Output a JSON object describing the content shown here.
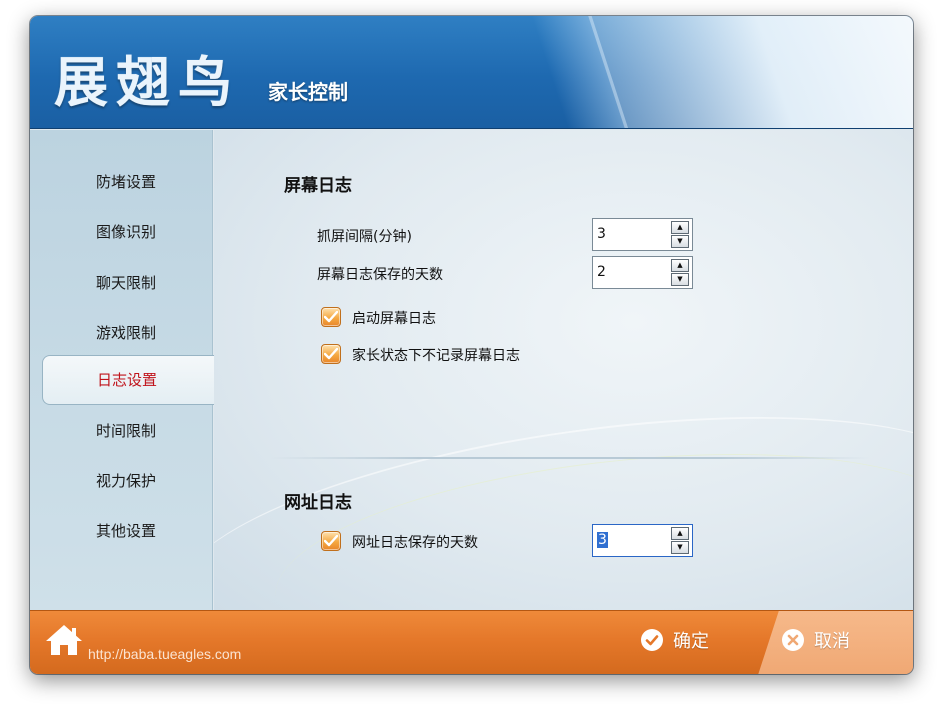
{
  "header": {
    "logo": "展翅鸟",
    "subtitle": "家长控制"
  },
  "sidebar": {
    "items": [
      {
        "label": "防堵设置",
        "active": false
      },
      {
        "label": "图像识别",
        "active": false
      },
      {
        "label": "聊天限制",
        "active": false
      },
      {
        "label": "游戏限制",
        "active": false
      },
      {
        "label": "日志设置",
        "active": true
      },
      {
        "label": "时间限制",
        "active": false
      },
      {
        "label": "视力保护",
        "active": false
      },
      {
        "label": "其他设置",
        "active": false
      }
    ]
  },
  "screen_log": {
    "title": "屏幕日志",
    "interval_label": "抓屏间隔(分钟)",
    "interval_value": "3",
    "keep_days_label": "屏幕日志保存的天数",
    "keep_days_value": "2",
    "enable_label": "启动屏幕日志",
    "enable_checked": true,
    "parent_mode_label": "家长状态下不记录屏幕日志",
    "parent_mode_checked": true
  },
  "url_log": {
    "title": "网址日志",
    "keep_days_label": "网址日志保存的天数",
    "keep_days_checked": true,
    "keep_days_value": "3"
  },
  "footer": {
    "url": "http://baba.tueagles.com",
    "ok_label": "确定",
    "cancel_label": "取消"
  },
  "colors": {
    "header_blue": "#1e69b0",
    "footer_orange": "#e5782a",
    "active_nav_text": "#c0131b"
  }
}
